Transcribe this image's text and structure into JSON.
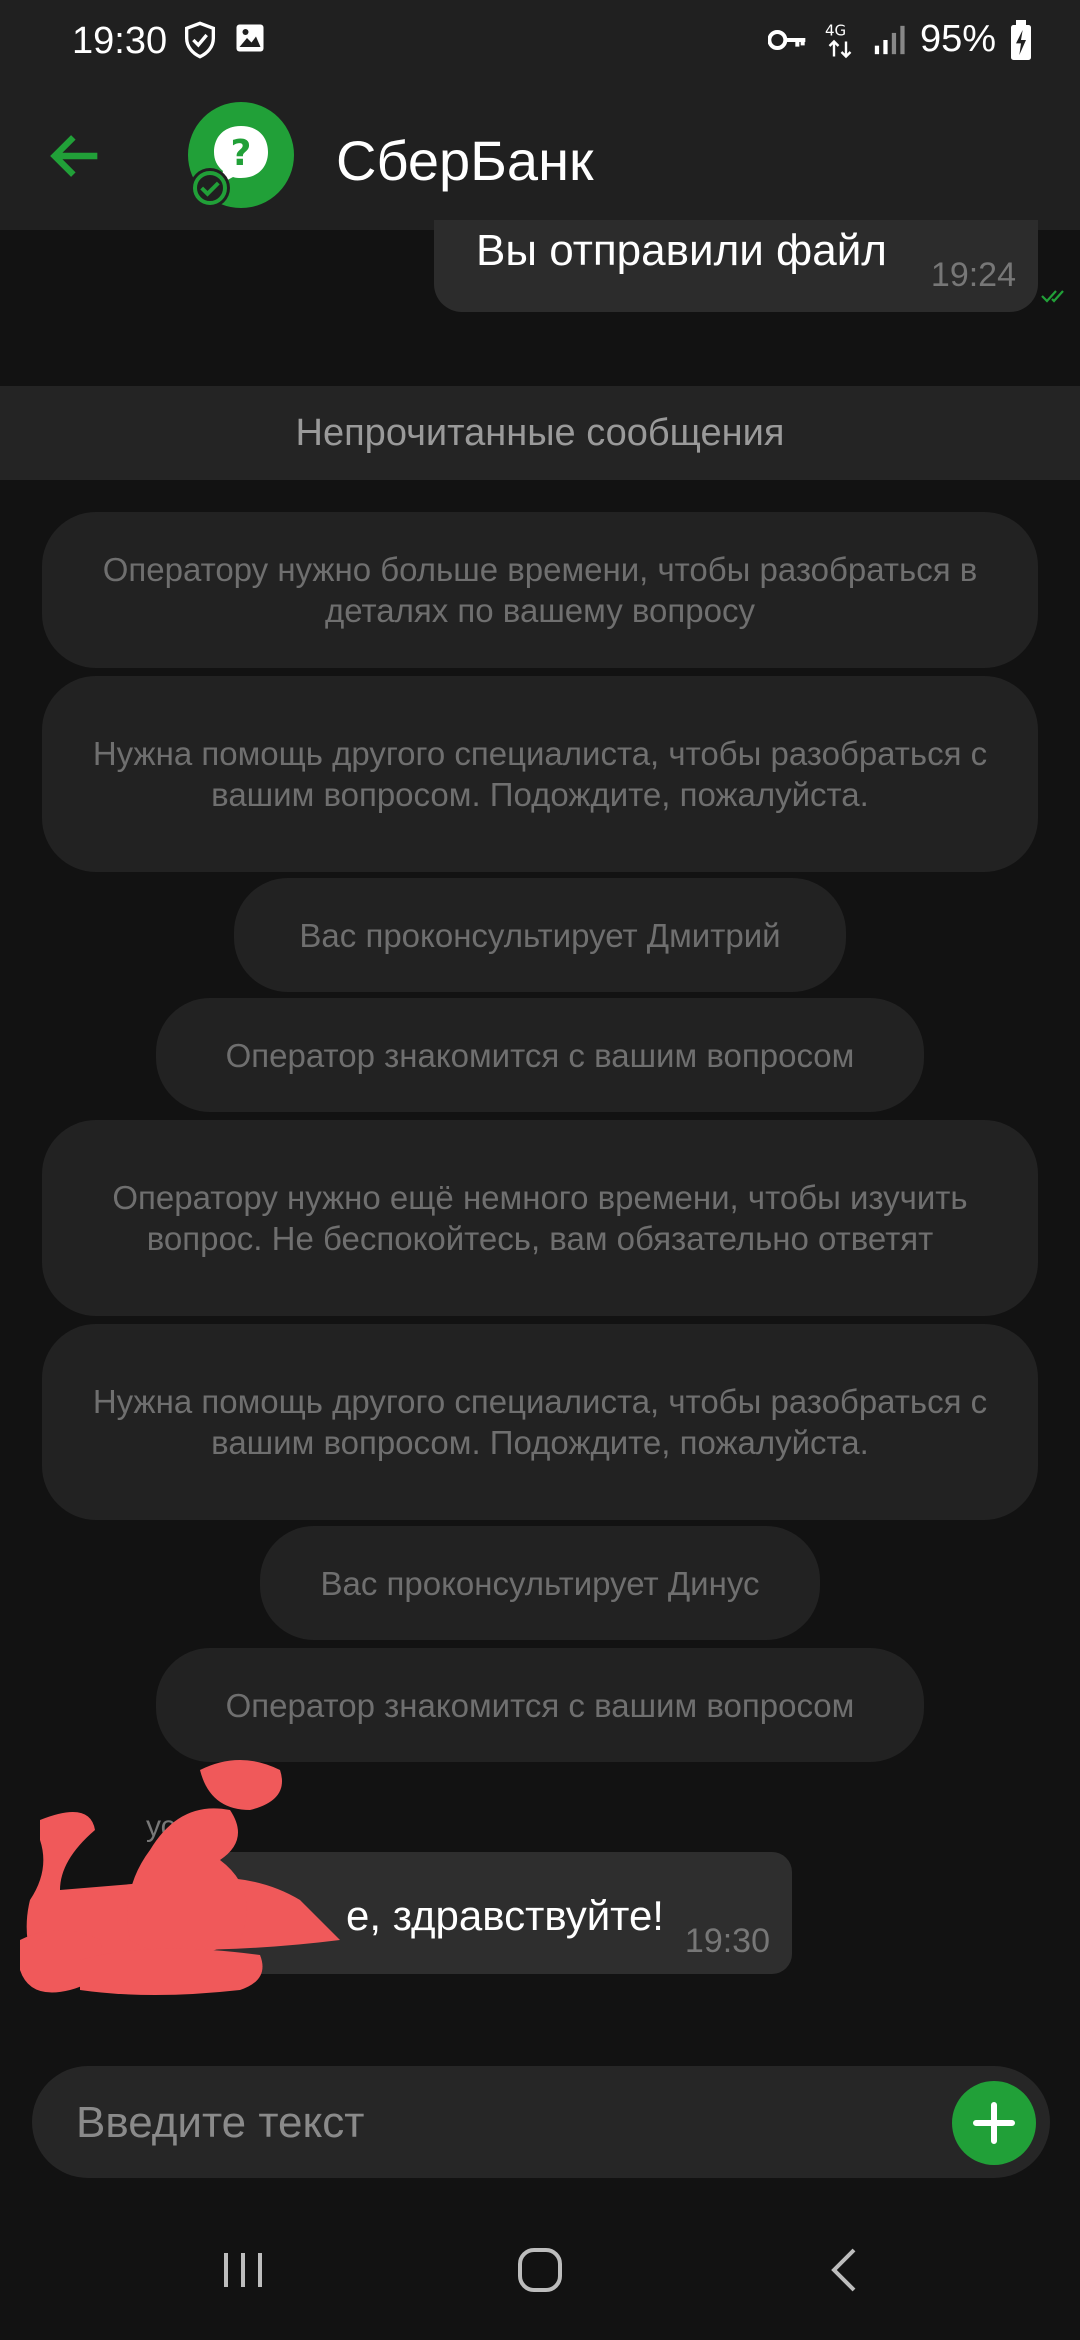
{
  "status_bar": {
    "time": "19:30",
    "battery": "95%",
    "network": "4G",
    "icons": [
      "shield-check-icon",
      "image-icon",
      "key-icon",
      "signal-icon",
      "battery-charging-icon"
    ]
  },
  "header": {
    "title": "СберБанк",
    "back_icon": "arrow-left-icon",
    "avatar_icon": "question-bubble-icon"
  },
  "messages": {
    "outgoing": {
      "text": "Вы отправили файл",
      "time": "19:24"
    },
    "unread_divider": "Непрочитанные сообщения",
    "system": [
      "Оператору нужно больше времени, чтобы разобраться в деталях по вашему вопросу",
      "Нужна помощь другого специалиста, чтобы разобраться с вашим вопросом. Подождите, пожалуйста.",
      "Вас проконсультирует Дмитрий",
      "Оператор знакомится с вашим вопросом",
      "Оператору нужно ещё немного времени, чтобы изучить вопрос. Не беспокойтесь, вам обязательно ответят",
      "Нужна помощь другого специалиста, чтобы разобраться с вашим вопросом. Подождите, пожалуйста.",
      "Вас проконсультирует Динус",
      "Оператор знакомится с вашим вопросом"
    ],
    "incoming": {
      "sender": "ус",
      "text": "е, здравствуйте!",
      "time": "19:30"
    }
  },
  "composer": {
    "placeholder": "Введите текст",
    "add_icon": "plus-icon"
  },
  "colors": {
    "accent": "#21a038",
    "background": "#121212",
    "bubble": "#2e2e2e",
    "scribble": "#f0595a"
  }
}
